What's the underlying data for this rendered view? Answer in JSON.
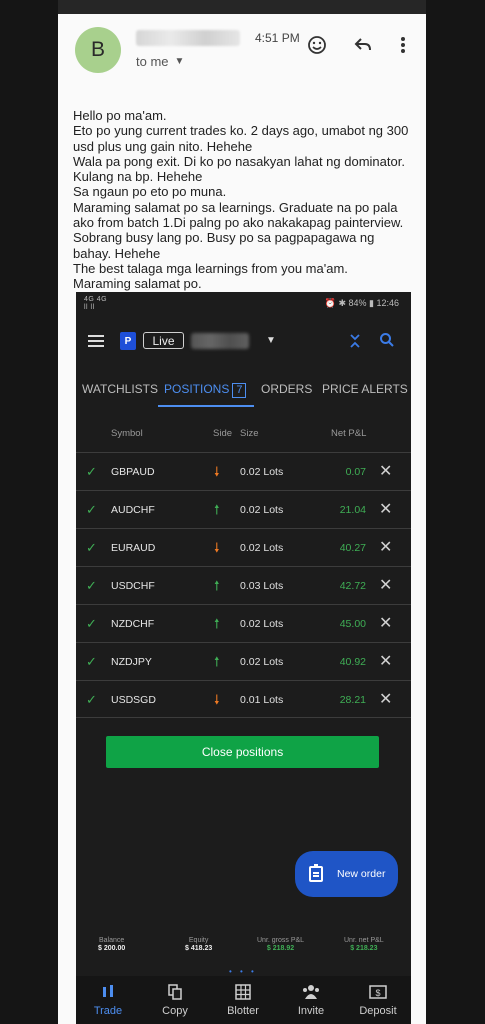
{
  "email": {
    "sender_initial": "B",
    "time": "4:51 PM",
    "recipient": "to me",
    "body_lines": [
      "Hello po ma'am.",
      "Eto po yung current trades ko. 2 days ago, umabot ng 300",
      "usd plus ung gain nito. Hehehe",
      "Wala pa pong exit. Di ko po nasakyan lahat ng dominator.",
      "Kulang na bp. Hehehe",
      "Sa ngaun po eto po muna.",
      "Maraming salamat po sa learnings. Graduate na po pala",
      "ako from batch 1.Di palng po ako nakakapag painterview.",
      "Sobrang busy lang po. Busy po sa pagpapagawa ng",
      "bahay. Hehehe",
      "The best talaga mga learnings from you ma'am.",
      "Maraming salamat po."
    ]
  },
  "app": {
    "status": {
      "left": "4G 4G\nll ll",
      "right": "⏰ ✱ 84% ▮ 12:46"
    },
    "logo": "P",
    "mode": "Live",
    "tabs": [
      {
        "label": "WATCHLISTS"
      },
      {
        "label": "POSITIONS",
        "count": "7"
      },
      {
        "label": "ORDERS"
      },
      {
        "label": "PRICE ALERTS"
      }
    ],
    "columns": {
      "symbol": "Symbol",
      "side": "Side",
      "size": "Size",
      "pnl": "Net P&L"
    },
    "positions": [
      {
        "symbol": "GBPAUD",
        "side": "sell",
        "size": "0.02 Lots",
        "pnl": "0.07"
      },
      {
        "symbol": "AUDCHF",
        "side": "buy",
        "size": "0.02 Lots",
        "pnl": "21.04"
      },
      {
        "symbol": "EURAUD",
        "side": "sell",
        "size": "0.02 Lots",
        "pnl": "40.27"
      },
      {
        "symbol": "USDCHF",
        "side": "buy",
        "size": "0.03 Lots",
        "pnl": "42.72"
      },
      {
        "symbol": "NZDCHF",
        "side": "buy",
        "size": "0.02 Lots",
        "pnl": "45.00"
      },
      {
        "symbol": "NZDJPY",
        "side": "buy",
        "size": "0.02 Lots",
        "pnl": "40.92"
      },
      {
        "symbol": "USDSGD",
        "side": "sell",
        "size": "0.01 Lots",
        "pnl": "28.21"
      }
    ],
    "close_label": "Close positions",
    "new_order_label": "New order",
    "summary": {
      "balance_label": "Balance",
      "balance": "$ 200.00",
      "equity_label": "Equity",
      "equity": "$ 418.23",
      "gross_label": "Unr. gross P&L",
      "gross": "$ 218.92",
      "net_label": "Unr. net P&L",
      "net": "$ 218.23"
    },
    "nav": [
      {
        "label": "Trade",
        "icon": "trade-icon"
      },
      {
        "label": "Copy",
        "icon": "copy-icon"
      },
      {
        "label": "Blotter",
        "icon": "blotter-icon"
      },
      {
        "label": "Invite",
        "icon": "invite-icon"
      },
      {
        "label": "Deposit",
        "icon": "deposit-icon"
      }
    ],
    "colors": {
      "accent": "#4d8ef0",
      "profit": "#3fae55",
      "sell": "#f07a23",
      "button": "#0fa346"
    }
  }
}
